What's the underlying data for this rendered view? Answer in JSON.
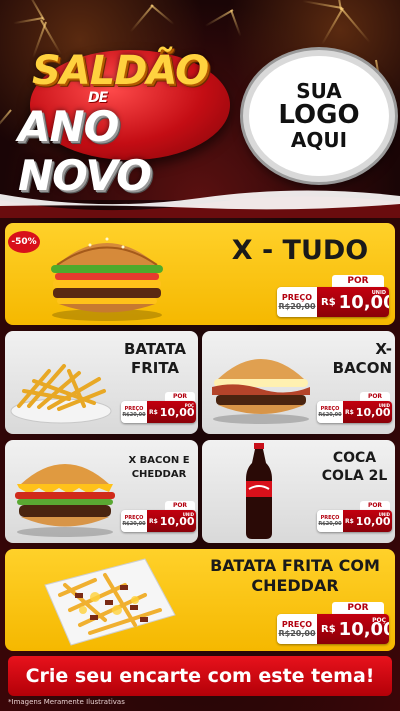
{
  "header": {
    "title_line1": "SALDÃO",
    "title_line2": "DE",
    "title_line3": "ANO NOVO",
    "logo_line1": "SUA",
    "logo_line2": "LOGO",
    "logo_line3": "AQUI"
  },
  "badge": "-50%",
  "currency": "R$",
  "labels": {
    "por": "POR",
    "preco": "PREÇO"
  },
  "featured": {
    "name": "X - TUDO",
    "old_price": "R$20,00",
    "price": "10,00",
    "unit": "UNID"
  },
  "items": [
    {
      "name_line1": "BATATA",
      "name_line2": "FRITA",
      "old_price": "R$20,00",
      "price": "10,00",
      "unit": "POÇ"
    },
    {
      "name_line1": "X-",
      "name_line2": "BACON",
      "old_price": "R$20,00",
      "price": "10,00",
      "unit": "UNID"
    },
    {
      "name_line1": "X BACON E",
      "name_line2": "CHEDDAR",
      "old_price": "R$20,00",
      "price": "10,00",
      "unit": "UNID"
    },
    {
      "name_line1": "COCA",
      "name_line2": "COLA 2L",
      "old_price": "R$20,00",
      "price": "10,00",
      "unit": "UNID"
    }
  ],
  "bottom_item": {
    "name_line1": "BATATA FRITA COM",
    "name_line2": "CHEDDAR",
    "old_price": "R$20,00",
    "price": "10,00",
    "unit": "POÇ"
  },
  "cta": "Crie seu encarte com este tema!",
  "disclaimer": "*Imagens Meramente Ilustrativas",
  "colors": {
    "brand_red": "#c3000f",
    "yellow": "#f5b800",
    "dark_red": "#5a0a0a"
  }
}
